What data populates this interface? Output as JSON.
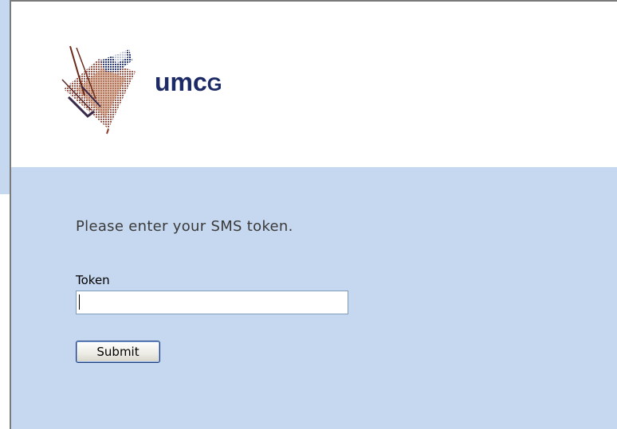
{
  "brand": {
    "logo_icon": "umcg-kite-logo",
    "name_main": "umc",
    "name_suffix": "G",
    "color": "#1c2a66"
  },
  "form": {
    "instruction": "Please enter your SMS token.",
    "token_label": "Token",
    "token_value": "",
    "submit_label": "Submit"
  },
  "colors": {
    "background_blue": "#c6d8ef",
    "header_white": "#ffffff"
  }
}
